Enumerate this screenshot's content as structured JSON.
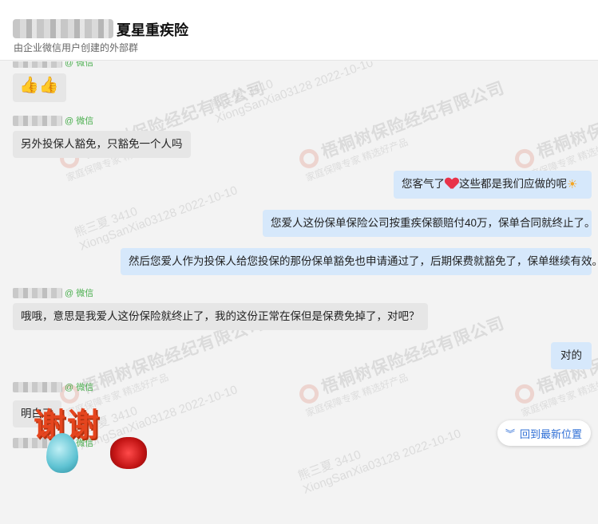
{
  "header": {
    "title": "夏星重疾险",
    "subtitle": "由企业微信用户创建的外部群"
  },
  "source_label": "@ 微信",
  "watermark": {
    "company": "梧桐树保险经纪有限公司",
    "slogan": "家庭保障专家 精选好产品",
    "user_line": "熊三夏 3410",
    "user_id": "XiongSanXia03128 2022-10-10"
  },
  "messages": [
    {
      "side": "left",
      "text": "👍👍",
      "show_sender": true
    },
    {
      "side": "left",
      "text": "另外投保人豁免，只豁免一个人吗",
      "show_sender": true
    },
    {
      "side": "right",
      "text_before": "您客气了",
      "text_after": "这些都是我们应做的呢"
    },
    {
      "side": "right",
      "text": "您爱人这份保单保险公司按重疾保额赔付40万，保单合同就终止了。"
    },
    {
      "side": "right",
      "text": "然后您爱人作为投保人给您投保的那份保单豁免也申请通过了，后期保费就豁免了，保单继续有效。"
    },
    {
      "side": "left",
      "text": "哦哦，意思是我爱人这份保险就终止了，我的这份正常在保但是保费免掉了，对吧？",
      "show_sender": true
    },
    {
      "side": "right",
      "text": "对的"
    },
    {
      "side": "left",
      "text": "明白了",
      "show_sender": true
    },
    {
      "side": "left",
      "sticker_text": "谢谢",
      "show_sender": true
    }
  ],
  "back_to_latest": "回到最新位置"
}
